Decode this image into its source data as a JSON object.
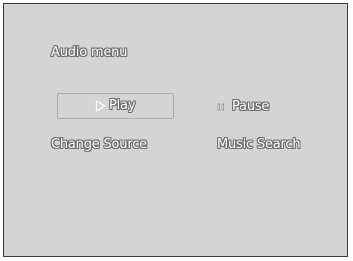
{
  "menu": {
    "title": "Audio menu",
    "play_label": "Play",
    "pause_label": "Pause",
    "change_source_label": "Change Source",
    "music_search_label": "Music Search"
  },
  "icons": {
    "play": "play-icon",
    "pause": "pause-icon"
  },
  "colors": {
    "background": "#d4d4d4",
    "text": "#ffffff",
    "text_outline": "#6e6e6e",
    "focus_border": "#ababab"
  }
}
